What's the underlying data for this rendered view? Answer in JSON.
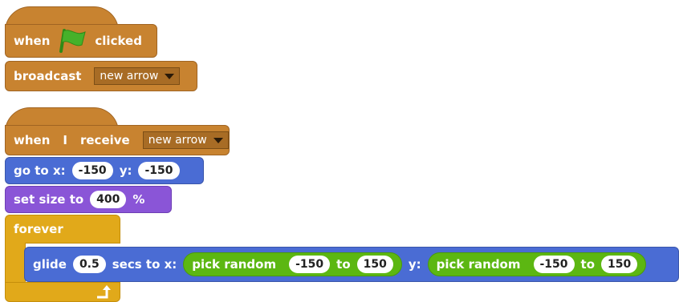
{
  "script1": {
    "when_label": "when",
    "clicked_label": "clicked",
    "broadcast_label": "broadcast",
    "broadcast_message": "new arrow",
    "flag_icon": "green-flag-icon"
  },
  "script2": {
    "when_label": "when",
    "i_label": "I",
    "receive_label": "receive",
    "receive_message": "new arrow",
    "goto_label": "go to x:",
    "goto_x": "-150",
    "goto_y_label": "y:",
    "goto_y": "-150",
    "setsize_label": "set size to",
    "setsize_value": "400",
    "percent": "%",
    "forever_label": "forever",
    "glide_label": "glide",
    "glide_secs": "0.5",
    "secs_label": "secs to x:",
    "y_label": "y:",
    "random_label": "pick random",
    "to_label": "to",
    "rand_x_min": "-150",
    "rand_x_max": "150",
    "rand_y_min": "-150",
    "rand_y_max": "150",
    "loop_arrow_icon": "loop-arrow-icon"
  },
  "colors": {
    "events": "#c88330",
    "motion": "#4a6cd4",
    "looks": "#8a55d7",
    "control": "#e1a91a",
    "operators": "#5cb712"
  }
}
